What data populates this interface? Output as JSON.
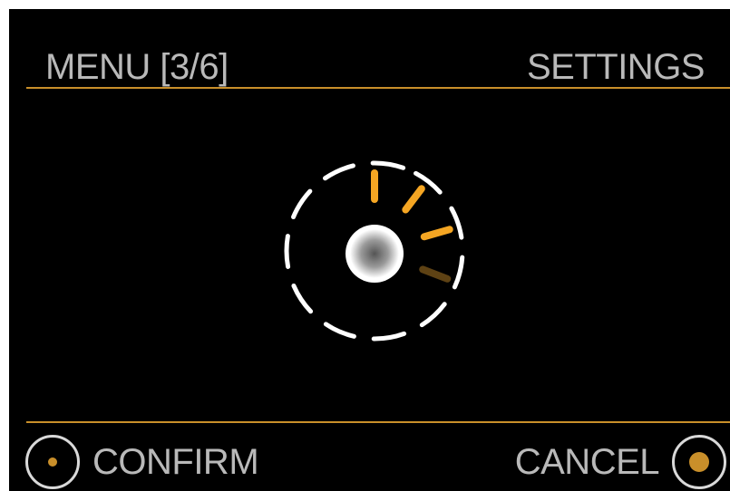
{
  "header": {
    "title": "MENU [3/6]",
    "section": "SETTINGS"
  },
  "footer": {
    "confirm_label": "CONFIRM",
    "cancel_label": "CANCEL"
  },
  "graphic": {
    "icon": "dial-knob-icon",
    "level_active_ticks": 3,
    "level_total_ticks": 4
  },
  "colors": {
    "accent": "#f5a623",
    "accent_dim": "#5e4214",
    "divider": "#c98f2a",
    "text": "#b9b9b9",
    "background": "#000000"
  }
}
